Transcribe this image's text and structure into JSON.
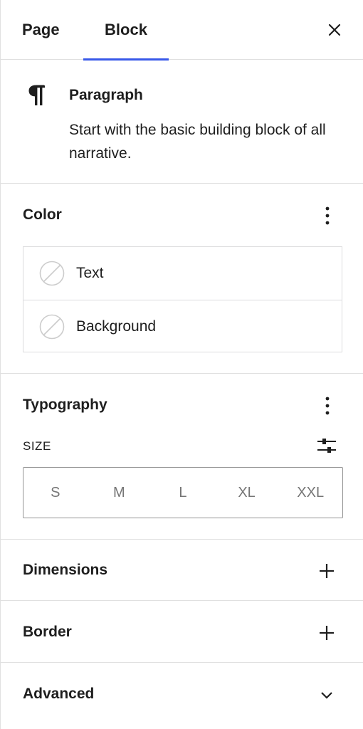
{
  "tabs": {
    "page_label": "Page",
    "block_label": "Block",
    "active": "Block"
  },
  "block": {
    "icon": "paragraph-icon",
    "title": "Paragraph",
    "description": "Start with the basic building block of all narrative."
  },
  "color": {
    "title": "Color",
    "options": [
      {
        "label": "Text",
        "icon": "empty-swatch-icon"
      },
      {
        "label": "Background",
        "icon": "empty-swatch-icon"
      }
    ]
  },
  "typography": {
    "title": "Typography",
    "size_label": "SIZE",
    "sizes": [
      "S",
      "M",
      "L",
      "XL",
      "XXL"
    ]
  },
  "dimensions": {
    "title": "Dimensions"
  },
  "border": {
    "title": "Border"
  },
  "advanced": {
    "title": "Advanced"
  },
  "colors": {
    "accent": "#3858e9",
    "divider": "#e0e0e0",
    "text": "#1e1e1e",
    "muted": "#757575"
  }
}
